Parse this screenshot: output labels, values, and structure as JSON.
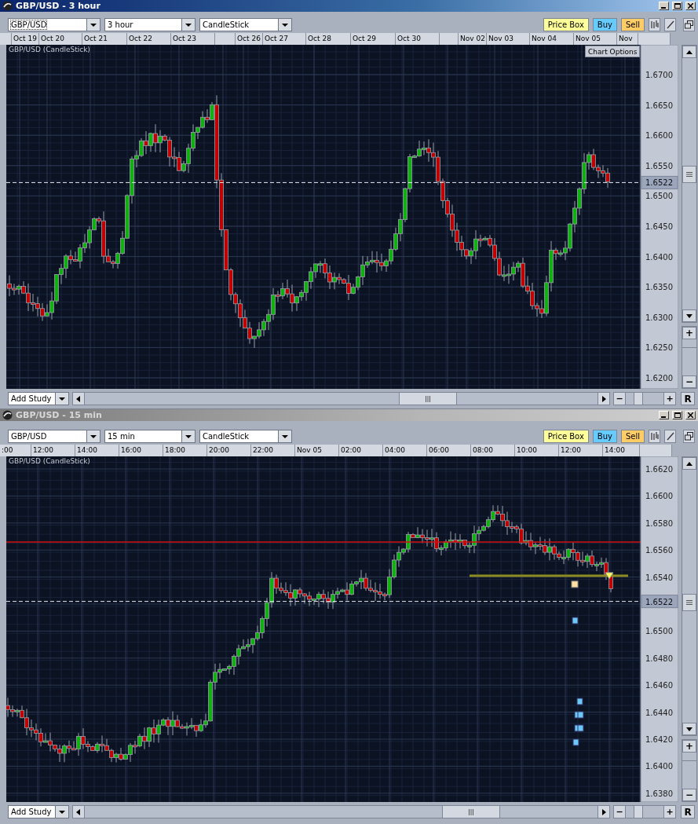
{
  "windows": [
    {
      "title": "GBP/USD - 3 hour",
      "active": true,
      "symbol": "GBP/USD",
      "interval": "3 hour",
      "chart_type": "CandleStick",
      "buttons": [
        {
          "label": "Price Box",
          "kind": "pricebox"
        },
        {
          "label": "Buy",
          "kind": "buy"
        },
        {
          "label": "Sell",
          "kind": "sell"
        }
      ],
      "time_labels": [
        "Oct 19",
        "Oct 20",
        "Oct 21",
        "Oct 22",
        "Oct 23",
        "Oct 26",
        "Oct 27",
        "Oct 28",
        "Oct 29",
        "Oct 30",
        "Nov 02",
        "Nov 03",
        "Nov 04",
        "Nov 05",
        "Nov"
      ],
      "chart_label": "GBP/USD (CandleStick)",
      "chart_options": "Chart Options",
      "price_labels": [
        "1.6700",
        "1.6650",
        "1.6600",
        "1.6550",
        "1.6500",
        "1.6450",
        "1.6400",
        "1.6350",
        "1.6300",
        "1.6250",
        "1.6200"
      ],
      "current_price": "1.6522",
      "add_study": "Add Study",
      "zoom_out": "−",
      "zoom_in": "+",
      "reset": "R"
    },
    {
      "title": "GBP/USD - 15 min",
      "active": false,
      "symbol": "GBP/USD",
      "interval": "15 min",
      "chart_type": "CandleStick",
      "buttons": [
        {
          "label": "Price Box",
          "kind": "pricebox"
        },
        {
          "label": "Buy",
          "kind": "buy"
        },
        {
          "label": "Sell",
          "kind": "sell"
        }
      ],
      "time_labels": [
        ":00",
        "12:00",
        "14:00",
        "16:00",
        "18:00",
        "20:00",
        "22:00",
        "Nov 05",
        "02:00",
        "04:00",
        "06:00",
        "08:00",
        "10:00",
        "12:00",
        "14:00"
      ],
      "chart_label": "GBP/USD (CandleStick)",
      "price_labels": [
        "1.6620",
        "1.6600",
        "1.6580",
        "1.6560",
        "1.6540",
        "1.6500",
        "1.6480",
        "1.6460",
        "1.6440",
        "1.6420",
        "1.6400",
        "1.6380"
      ],
      "current_price": "1.6522",
      "add_study": "Add Study",
      "zoom_out": "−",
      "zoom_in": "+",
      "reset": "R"
    }
  ]
}
